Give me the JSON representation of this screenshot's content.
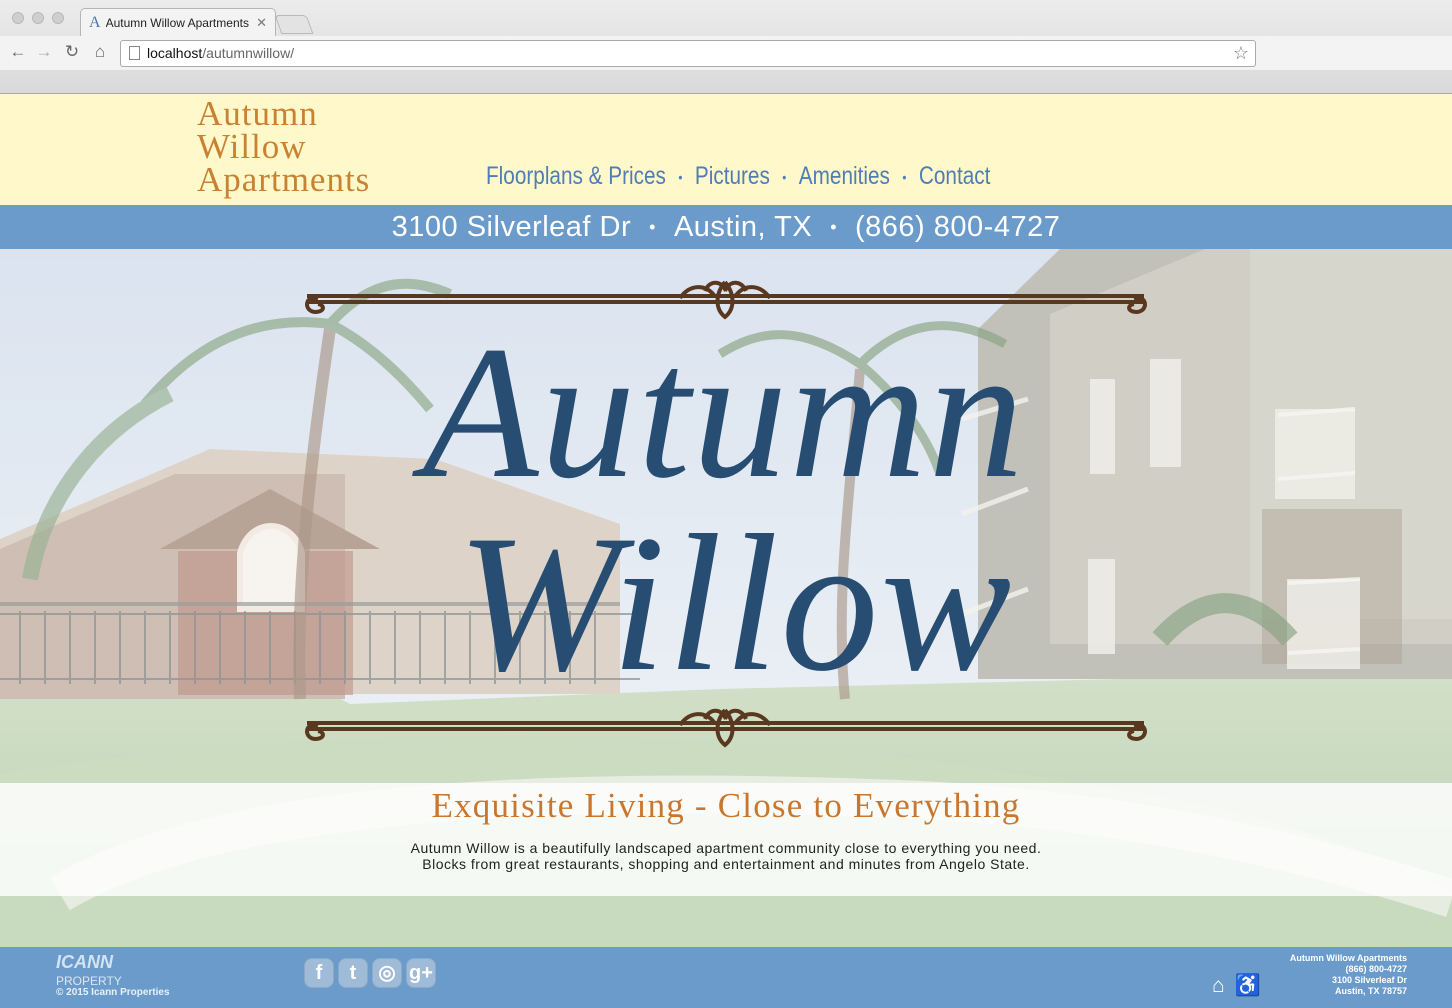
{
  "browser": {
    "tab_title": "Autumn Willow Apartments",
    "url_host": "localhost",
    "url_path": "/autumnwillow/"
  },
  "header": {
    "logo_lines": [
      "Autumn",
      "Willow",
      "Apartments"
    ],
    "nav": [
      "Floorplans & Prices",
      "Pictures",
      "Amenities",
      "Contact"
    ]
  },
  "address_bar": {
    "street": "3100 Silverleaf Dr",
    "city": "Austin, TX",
    "phone": "(866) 800-4727"
  },
  "hero": {
    "title_line_1": "Autumn",
    "title_line_2": "Willow",
    "tagline": "Exquisite Living - Close to Everything",
    "description_1": "Autumn Willow is a beautifully landscaped apartment community close to everything you need.",
    "description_2": "Blocks from great restaurants, shopping and entertainment and minutes from Angelo State."
  },
  "footer": {
    "brand_name": "ICANN",
    "brand_sub": "PROPERTY",
    "copyright": "© 2015 Icann Properties",
    "socials": [
      {
        "label": "f",
        "icon": "facebook-icon"
      },
      {
        "label": "t",
        "icon": "twitter-icon"
      },
      {
        "label": "◎",
        "icon": "instagram-icon"
      },
      {
        "label": "g+",
        "icon": "google-plus-icon"
      }
    ],
    "contact": [
      "Autumn Willow Apartments",
      "(866) 800-4727",
      "3100 Silverleaf Dr",
      "Austin, TX 78757"
    ],
    "access_icons": [
      "equal-housing-icon",
      "accessibility-icon"
    ]
  },
  "colors": {
    "accent_blue": "#6b9bcb",
    "brand_orange": "#c98231",
    "header_cream": "#fff8ca",
    "title_navy": "#274d73"
  }
}
